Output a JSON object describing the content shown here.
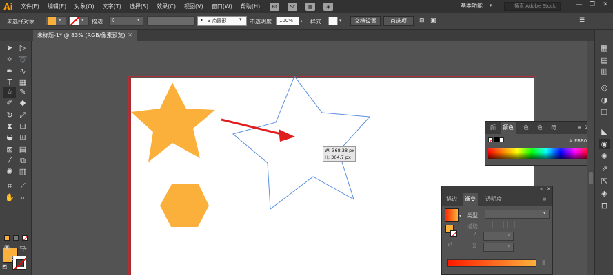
{
  "app": {
    "logo": "Ai"
  },
  "menu": [
    "文件(F)",
    "编辑(E)",
    "对象(O)",
    "文字(T)",
    "选择(S)",
    "效果(C)",
    "视图(V)",
    "窗口(W)",
    "帮助(H)"
  ],
  "menubar_icons": [
    "Br",
    "St"
  ],
  "workspace": "基本功能",
  "search": {
    "placeholder": "搜索 Adobe Stock"
  },
  "window_controls": {
    "minimize": "—",
    "restore": "❐",
    "close": "✕"
  },
  "control_bar": {
    "selection_label": "未选择对象",
    "stroke_label": "描边:",
    "stroke_style": "3 点圆形",
    "opacity_label": "不透明度:",
    "opacity_value": "100%",
    "style_label": "样式:",
    "doc_setup": "文档设置",
    "prefs": "首选项"
  },
  "document_tab": {
    "title": "未标题-1* @ 83% (RGB/像素预览)",
    "close": "✕"
  },
  "tooltip": {
    "w": "W: 368.38 px",
    "h": "H: 364.7 px"
  },
  "color_panel": {
    "tabs": [
      "颜",
      "颜色",
      "色",
      "色",
      "符"
    ],
    "hex_value": "FBB03B"
  },
  "gradient_panel": {
    "tabs": [
      "描边",
      "渐变",
      "透明度"
    ],
    "type_label": "类型:",
    "stroke_label": "描边:"
  },
  "colors": {
    "fill": "#fbb03b",
    "arrow": "#e01e1e",
    "star_outline": "#5b8fe0",
    "artboard_border": "#b0303a"
  }
}
